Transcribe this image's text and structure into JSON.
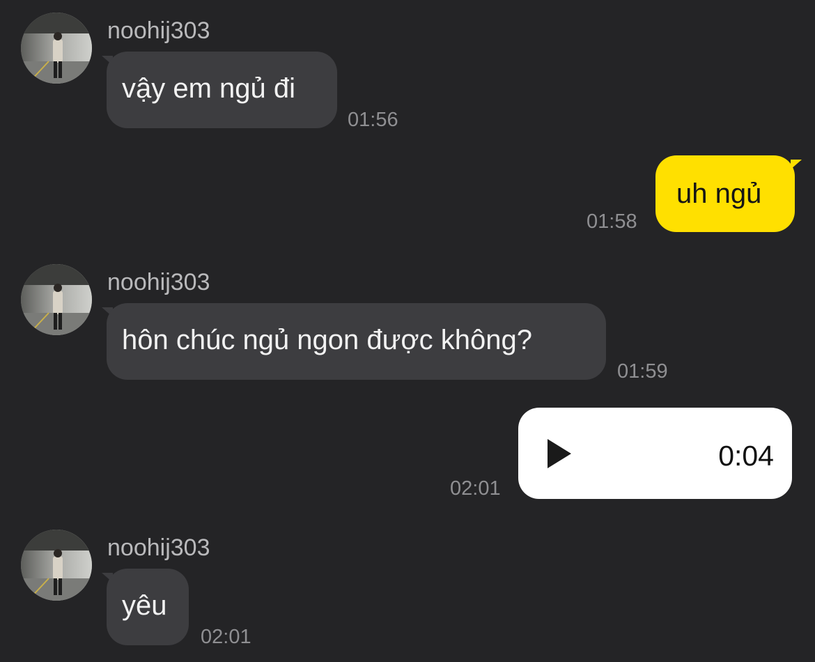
{
  "colors": {
    "background": "#242426",
    "incoming_bubble": "#3d3d40",
    "outgoing_bubble": "#ffe000",
    "voice_bubble": "#ffffff",
    "timestamp": "#8f8f92",
    "sender_name": "#b9b9bb"
  },
  "messages": [
    {
      "direction": "incoming",
      "sender": "noohij303",
      "text": "vậy em ngủ đi",
      "time": "01:56",
      "avatar": "avatar-photo"
    },
    {
      "direction": "outgoing",
      "text": "uh ngủ",
      "time": "01:58"
    },
    {
      "direction": "incoming",
      "sender": "noohij303",
      "text": "hôn chúc ngủ ngon được không?",
      "time": "01:59",
      "avatar": "avatar-photo"
    },
    {
      "direction": "outgoing",
      "type": "voice",
      "icon": "play-icon",
      "duration": "0:04",
      "time": "02:01"
    },
    {
      "direction": "incoming",
      "sender": "noohij303",
      "text": "yêu",
      "time": "02:01",
      "avatar": "avatar-photo"
    }
  ]
}
